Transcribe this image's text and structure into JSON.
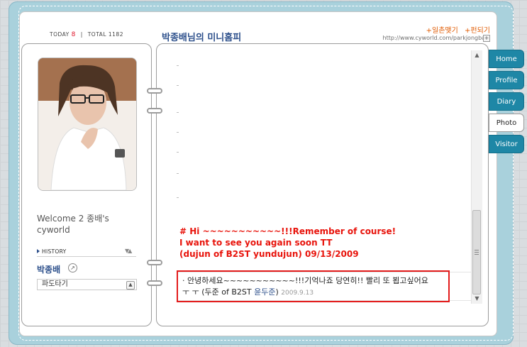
{
  "header": {
    "today_label": "TODAY",
    "today_value": "8",
    "separator": "|",
    "total_label": "TOTAL",
    "total_value": "1182",
    "title": "박종배님의 미니홈피",
    "link_ilchon": "+일촌맺기",
    "link_pyeon": "+펀되기",
    "url": "http://www.cyworld.com/parkjongbae",
    "url_button": "+"
  },
  "profile": {
    "welcome": "Welcome 2 종배's cyworld",
    "history_label": "HISTORY",
    "history_arrows": "▼▲",
    "owner_name": "박종배",
    "owner_icon": "↗",
    "wave_label": "파도타기",
    "wave_button": "▲"
  },
  "content": {
    "message_lines": [
      "# Hi ~~~~~~~~~~~!!!Remember of course!",
      "I want to see you again soon TT",
      "(dujun of B2ST yundujun) 09/13/2009"
    ],
    "guestbook": {
      "bullet": "·",
      "text_line1": "안녕하세요~~~~~~~~~~~!!!기억나죠 당연히!! 빨리 또 뵙고싶어요",
      "text_line2_prefix": "ㅜ ㅜ (두준 of B2ST ",
      "nick": "윤두준",
      "text_line2_suffix": ")",
      "date": "2009.9.13"
    }
  },
  "scrollbar": {
    "up_arrow": "▲",
    "down_arrow": "▼"
  },
  "tabs": [
    {
      "label": "Home",
      "active": false
    },
    {
      "label": "Profile",
      "active": false
    },
    {
      "label": "Diary",
      "active": false
    },
    {
      "label": "Photo",
      "active": true
    },
    {
      "label": "Visitor",
      "active": false
    }
  ],
  "colors": {
    "frame": "#a9d1dc",
    "tab": "#1e87a6",
    "title": "#2c4f8b",
    "message": "#e8140c"
  }
}
